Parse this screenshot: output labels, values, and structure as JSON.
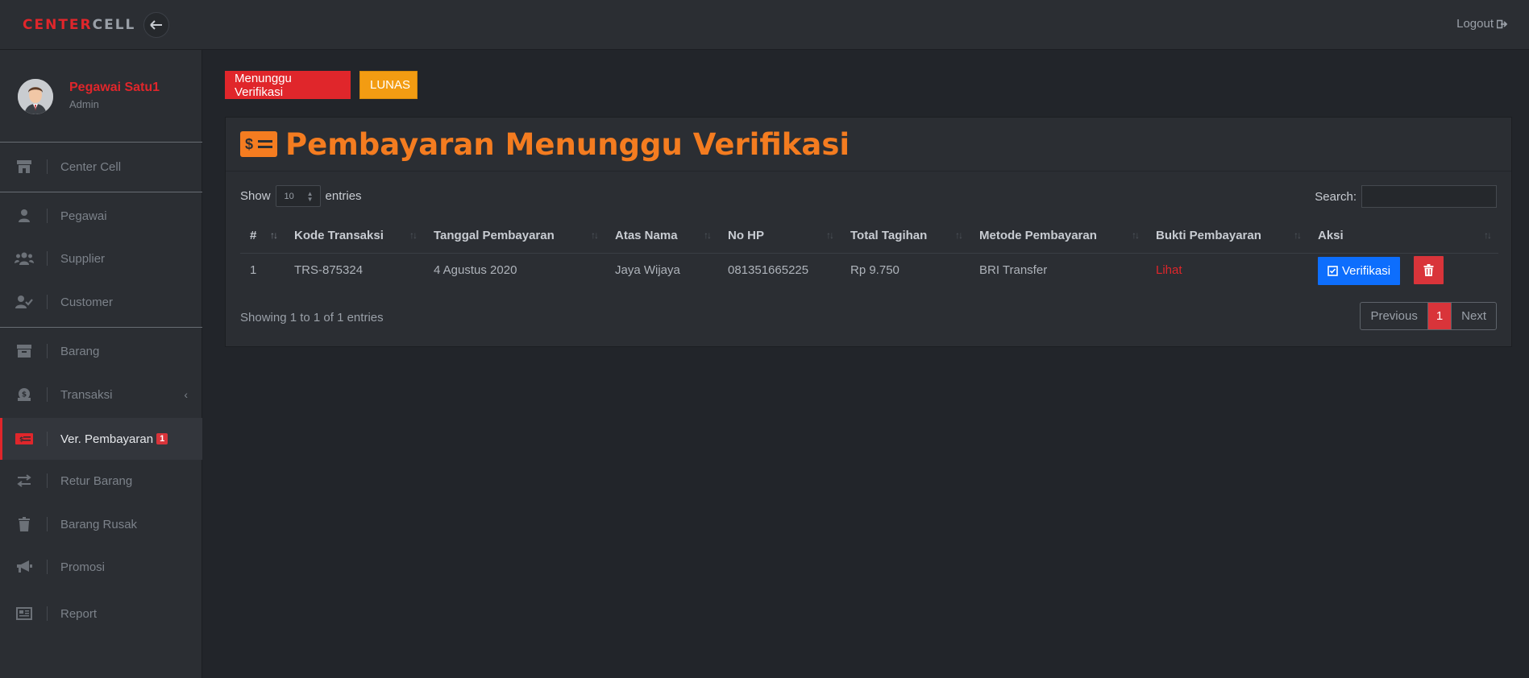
{
  "header": {
    "brand_part1": "CENTER",
    "brand_part2": "CELL",
    "logout_label": "Logout"
  },
  "profile": {
    "name": "Pegawai Satu1",
    "role": "Admin"
  },
  "sidebar": {
    "items": [
      {
        "label": "Center Cell",
        "icon": "store-icon"
      },
      {
        "label": "Pegawai",
        "icon": "user-icon"
      },
      {
        "label": "Supplier",
        "icon": "users-icon"
      },
      {
        "label": "Customer",
        "icon": "user-check-icon"
      },
      {
        "label": "Barang",
        "icon": "archive-icon"
      },
      {
        "label": "Transaksi",
        "icon": "money-bag-icon"
      },
      {
        "label": "Ver. Pembayaran",
        "icon": "money-bill-icon",
        "badge": "1"
      },
      {
        "label": "Retur Barang",
        "icon": "exchange-icon"
      },
      {
        "label": "Barang Rusak",
        "icon": "trash-icon"
      },
      {
        "label": "Promosi",
        "icon": "megaphone-icon"
      },
      {
        "label": "Report",
        "icon": "report-icon"
      }
    ]
  },
  "tabs": {
    "waiting": "Menunggu Verifikasi",
    "paid": "LUNAS"
  },
  "card": {
    "title": "Pembayaran Menunggu Verifikasi",
    "icon_symbol": "$"
  },
  "table_controls": {
    "show_label": "Show",
    "entries_value": "10",
    "entries_label": "entries",
    "search_label": "Search:"
  },
  "table": {
    "columns": [
      "#",
      "Kode Transaksi",
      "Tanggal Pembayaran",
      "Atas Nama",
      "No HP",
      "Total Tagihan",
      "Metode Pembayaran",
      "Bukti Pembayaran",
      "Aksi"
    ],
    "rows": [
      {
        "no": "1",
        "kode": "TRS-875324",
        "tanggal": "4 Agustus 2020",
        "nama": "Jaya Wijaya",
        "hp": "081351665225",
        "total": "Rp 9.750",
        "metode": "BRI Transfer",
        "bukti": "Lihat",
        "verify_label": "Verifikasi"
      }
    ]
  },
  "pagination": {
    "info": "Showing 1 to 1 of 1 entries",
    "previous": "Previous",
    "current": "1",
    "next": "Next"
  },
  "colors": {
    "accent_red": "#e0262b",
    "accent_orange": "#f47c20",
    "primary_blue": "#0d6efd"
  }
}
